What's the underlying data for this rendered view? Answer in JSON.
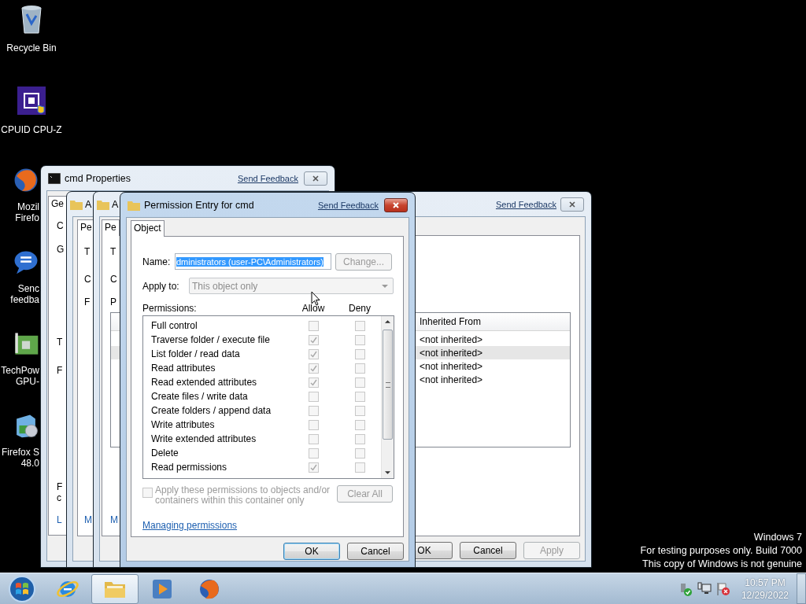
{
  "desktop": {
    "icons": [
      {
        "kind": "recycle",
        "label_lines": [
          "Recycle Bin"
        ]
      },
      {
        "kind": "cpuz",
        "label_lines": [
          "CPUID CPU-Z"
        ]
      },
      {
        "kind": "firefox",
        "label_lines": [
          "Mozil",
          "Firefo"
        ]
      },
      {
        "kind": "feedback",
        "label_lines": [
          "Senc",
          "feedba"
        ]
      },
      {
        "kind": "gpu",
        "label_lines": [
          "TechPow",
          "GPU-"
        ]
      },
      {
        "kind": "setup",
        "label_lines": [
          "Firefox S",
          "48.0"
        ]
      }
    ],
    "watermark": [
      "Windows 7",
      "For testing purposes only. Build 7000",
      "This copy of Windows is not genuine"
    ]
  },
  "cmd_properties": {
    "title": "cmd Properties",
    "feedback_link": "Send Feedback",
    "tab": "Ge",
    "fragments": [
      "C",
      "G",
      "T",
      "F",
      "F",
      "c",
      "L"
    ]
  },
  "security_back": {
    "title": "A",
    "tab": "Pe",
    "fragments": [
      "T",
      "C",
      "F",
      "M"
    ]
  },
  "security_front": {
    "title": "A",
    "feedback_link": "Send Feedback",
    "tab": "Pe",
    "fragments_above": [
      "T",
      "C",
      "P"
    ],
    "table": {
      "columns": [
        "Inherited From"
      ],
      "rows": [
        {
          "cells": [
            "<not inherited>"
          ],
          "selected": false
        },
        {
          "cells": [
            "<not inherited>"
          ],
          "selected": true
        },
        {
          "cells": [
            "<not inherited>"
          ],
          "selected": false
        },
        {
          "cells": [
            "<not inherited>"
          ],
          "selected": false
        }
      ]
    },
    "fragments_below": [
      "M"
    ],
    "buttons": [
      {
        "label": "OK",
        "disabled": false
      },
      {
        "label": "Cancel",
        "disabled": false
      },
      {
        "label": "Apply",
        "disabled": true
      }
    ]
  },
  "permission_entry": {
    "title": "Permission Entry for cmd",
    "feedback_link": "Send Feedback",
    "tabs": [
      {
        "label": "Object",
        "selected": true
      }
    ],
    "name": {
      "label": "Name:",
      "value": "dministrators (user-PC\\Administrators)",
      "selected": true
    },
    "change_button": {
      "label": "Change...",
      "disabled": true
    },
    "apply_to": {
      "label": "Apply to:",
      "value": "This object only",
      "disabled": true
    },
    "permissions": {
      "label": "Permissions:",
      "allow_header": "Allow",
      "deny_header": "Deny",
      "disabled": true,
      "rows": [
        {
          "name": "Full control",
          "allow": false,
          "deny": false
        },
        {
          "name": "Traverse folder / execute file",
          "allow": true,
          "deny": false
        },
        {
          "name": "List folder / read data",
          "allow": true,
          "deny": false
        },
        {
          "name": "Read attributes",
          "allow": true,
          "deny": false
        },
        {
          "name": "Read extended attributes",
          "allow": true,
          "deny": false
        },
        {
          "name": "Create files / write data",
          "allow": false,
          "deny": false
        },
        {
          "name": "Create folders / append data",
          "allow": false,
          "deny": false
        },
        {
          "name": "Write attributes",
          "allow": false,
          "deny": false
        },
        {
          "name": "Write extended attributes",
          "allow": false,
          "deny": false
        },
        {
          "name": "Delete",
          "allow": false,
          "deny": false
        },
        {
          "name": "Read permissions",
          "allow": true,
          "deny": false
        }
      ]
    },
    "apply_inside": {
      "text": "Apply these permissions to objects and/or containers within this container only",
      "checked": false,
      "disabled": true
    },
    "clear_all": {
      "label": "Clear All",
      "disabled": true
    },
    "help_link": "Managing permissions",
    "buttons": [
      {
        "label": "OK",
        "default": true
      },
      {
        "label": "Cancel",
        "default": false
      }
    ]
  },
  "taskbar": {
    "items": [
      {
        "kind": "ie",
        "active": false
      },
      {
        "kind": "explorer",
        "active": true
      },
      {
        "kind": "media",
        "active": false
      },
      {
        "kind": "firefox",
        "active": false
      }
    ],
    "tray": [
      {
        "kind": "device"
      },
      {
        "kind": "network"
      },
      {
        "kind": "flag"
      }
    ],
    "time": "10:57 PM",
    "date": "12/29/2022"
  }
}
